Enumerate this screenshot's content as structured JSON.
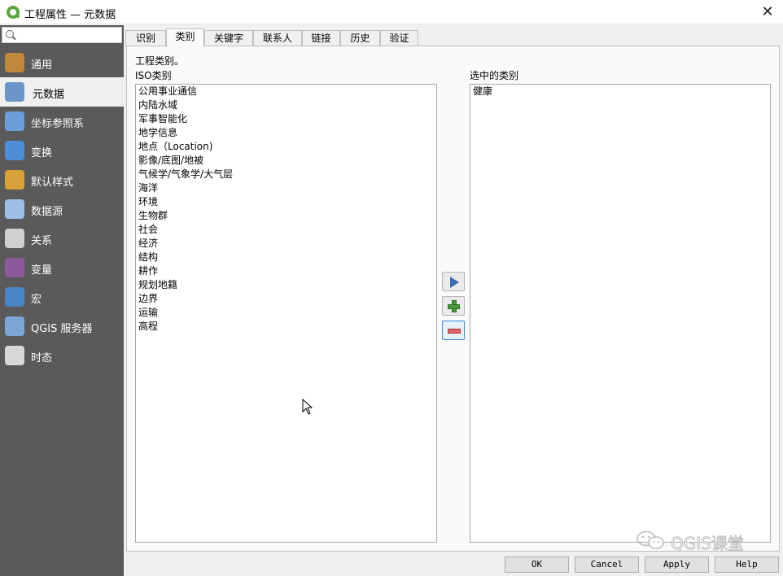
{
  "window": {
    "title": "工程属性 — 元数据",
    "close_glyph": "✕"
  },
  "sidebar": {
    "search_placeholder": "",
    "items": [
      {
        "label": "通用",
        "icon": "wrench-hammer-icon",
        "color": "#c0883a"
      },
      {
        "label": "元数据",
        "icon": "metadata-document-icon",
        "color": "#6a95c9",
        "active": true
      },
      {
        "label": "坐标参照系",
        "icon": "globe-crs-icon",
        "color": "#6a9fd8"
      },
      {
        "label": "变换",
        "icon": "globe-transform-icon",
        "color": "#4d8ed6"
      },
      {
        "label": "默认样式",
        "icon": "paint-brush-icon",
        "color": "#d9a13a"
      },
      {
        "label": "数据源",
        "icon": "table-datasource-icon",
        "color": "#9bbfe6"
      },
      {
        "label": "关系",
        "icon": "relation-tables-icon",
        "color": "#d0d0d0"
      },
      {
        "label": "变量",
        "icon": "variable-epsilon-icon",
        "color": "#8c5a9a"
      },
      {
        "label": "宏",
        "icon": "gear-macro-icon",
        "color": "#4a86c6"
      },
      {
        "label": "QGIS 服务器",
        "icon": "map-server-icon",
        "color": "#7aa6d6"
      },
      {
        "label": "时态",
        "icon": "clock-temporal-icon",
        "color": "#d8d8d8"
      }
    ]
  },
  "tabs": [
    {
      "label": "识别"
    },
    {
      "label": "类别",
      "active": true
    },
    {
      "label": "关键字"
    },
    {
      "label": "联系人"
    },
    {
      "label": "链接"
    },
    {
      "label": "历史"
    },
    {
      "label": "验证"
    }
  ],
  "categories": {
    "intro": "工程类别。",
    "iso_title": "ISO类别",
    "selected_title": "选中的类别",
    "iso_items": [
      "公用事业通信",
      "内陆水域",
      "军事智能化",
      "地学信息",
      "地点（Location)",
      "影像/底图/地被",
      "气候学/气象学/大气层",
      "海洋",
      "环境",
      "生物群",
      "社会",
      "经济",
      "结构",
      "耕作",
      "规划地籍",
      "边界",
      "运输",
      "高程"
    ],
    "selected_items": [
      "健康"
    ],
    "buttons": {
      "add_icon": "play-arrow-icon",
      "new_icon": "plus-icon",
      "remove_icon": "minus-icon"
    }
  },
  "footer": {
    "ok": "OK",
    "cancel": "Cancel",
    "apply": "Apply",
    "help": "Help"
  },
  "watermark": {
    "text": "QGIS课堂",
    "icon": "wechat-icon"
  }
}
